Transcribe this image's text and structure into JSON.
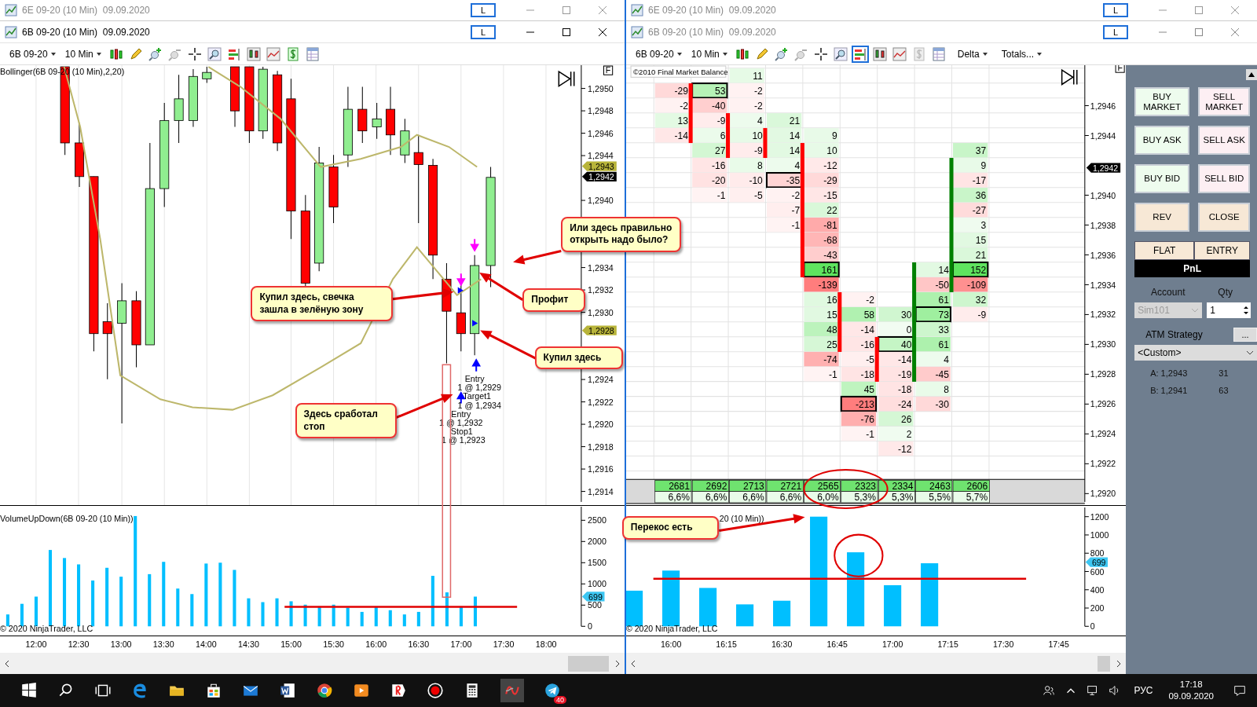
{
  "background_windows": [
    {
      "title": "6E 09-20 (10 Min)  09.09.2020",
      "button": "L"
    },
    {
      "title": "6E 09-20 (10 Min)  09.09.2020",
      "button": "L"
    }
  ],
  "left_window": {
    "title": "6B 09-20 (10 Min)  09.09.2020",
    "button": "L",
    "toolbar": {
      "instrument": "6B 09-20",
      "interval": "10 Min"
    },
    "indicator_label": "Bollinger(6B 09-20 (10 Min),2,20)",
    "flag": "F",
    "price_axis": [
      "1,2950",
      "1,2948",
      "1,2946",
      "1,2944",
      "1,2940",
      "1,2934",
      "1,2932",
      "1,2930",
      "1,2924",
      "1,2922",
      "1,2920",
      "1,2918",
      "1,2916",
      "1,2914"
    ],
    "price_markers": [
      {
        "text": "1,2943",
        "kind": "band"
      },
      {
        "text": "1,2942",
        "kind": "last"
      },
      {
        "text": "1,2928",
        "kind": "band"
      }
    ],
    "order_labels": [
      "Entry",
      "1 @ 1,2929",
      "Target1",
      "1 @ 1,2934",
      "Entry",
      "1 @ 1,2932",
      "Stop1",
      "1 @ 1,2923"
    ],
    "volume": {
      "label": "VolumeUpDown(6B 09-20 (10 Min))",
      "copyright": "© 2020 NinjaTrader, LLC",
      "chart_data": {
        "type": "bar",
        "ylim": [
          0,
          2820
        ],
        "yticks": [
          0,
          500,
          1000,
          1500,
          2000,
          2500
        ],
        "annotations": [
          "699"
        ],
        "categories": [
          null,
          null,
          "12:00",
          null,
          null,
          "12:30",
          null,
          null,
          "13:00",
          null,
          null,
          "13:30",
          null,
          null,
          "14:00",
          null,
          null,
          "14:30",
          null,
          null,
          "15:00",
          null,
          null,
          "15:30",
          null,
          null,
          "16:00",
          null,
          null,
          "16:30",
          null,
          null,
          "17:00",
          null,
          null,
          "17:30",
          null,
          null,
          "18:00"
        ],
        "values": [
          280,
          530,
          700,
          1800,
          1610,
          1460,
          1080,
          1380,
          1170,
          2600,
          1230,
          1520,
          890,
          760,
          1480,
          1500,
          1330,
          660,
          570,
          660,
          590,
          510,
          470,
          510,
          440,
          340,
          470,
          380,
          280,
          340,
          1190,
          800,
          470,
          700,
          null,
          null,
          null,
          null,
          null
        ]
      }
    }
  },
  "right_window": {
    "title": "6B 09-20 (10 Min)  09.09.2020",
    "button": "L",
    "toolbar": {
      "instrument": "6B 09-20",
      "interval": "10 Min",
      "menus": [
        "Delta",
        "Totals..."
      ]
    },
    "flag": "F",
    "watermark": "©2010 Final Market Balance",
    "footprint": {
      "rows": [
        [
          null,
          null,
          {
            "text": "11",
            "boxed": false
          },
          null,
          null,
          null,
          null,
          null,
          null
        ],
        [
          {
            "text": "-29",
            "boxed": false
          },
          {
            "text": "53",
            "boxed": true
          },
          {
            "text": "-2",
            "boxed": false
          },
          null,
          null,
          null,
          null,
          null,
          null
        ],
        [
          {
            "text": "-2",
            "boxed": false
          },
          {
            "text": "-40",
            "boxed": false
          },
          {
            "text": "-2",
            "boxed": false
          },
          null,
          null,
          null,
          null,
          null,
          null
        ],
        [
          {
            "text": "13",
            "boxed": false
          },
          {
            "text": "-9",
            "boxed": false
          },
          {
            "text": "4",
            "boxed": false
          },
          {
            "text": "21",
            "boxed": false
          },
          null,
          null,
          null,
          null,
          null
        ],
        [
          {
            "text": "-14",
            "boxed": false
          },
          {
            "text": "6",
            "boxed": false
          },
          {
            "text": "10",
            "boxed": false
          },
          {
            "text": "14",
            "boxed": false
          },
          {
            "text": "9",
            "boxed": false
          },
          null,
          null,
          null,
          null
        ],
        [
          null,
          {
            "text": "27",
            "boxed": false
          },
          {
            "text": "-9",
            "boxed": false
          },
          {
            "text": "14",
            "boxed": false
          },
          {
            "text": "10",
            "boxed": false
          },
          null,
          null,
          null,
          {
            "text": "37",
            "boxed": false
          }
        ],
        [
          null,
          {
            "text": "-16",
            "boxed": false
          },
          {
            "text": "8",
            "boxed": false
          },
          {
            "text": "4",
            "boxed": false
          },
          {
            "text": "-12",
            "boxed": false
          },
          null,
          null,
          null,
          {
            "text": "9",
            "boxed": false
          }
        ],
        [
          null,
          {
            "text": "-20",
            "boxed": false
          },
          {
            "text": "-10",
            "boxed": false
          },
          {
            "text": "-35",
            "boxed": true
          },
          {
            "text": "-29",
            "boxed": false
          },
          null,
          null,
          null,
          {
            "text": "-17",
            "boxed": false
          }
        ],
        [
          null,
          {
            "text": "-1",
            "boxed": false
          },
          {
            "text": "-5",
            "boxed": false
          },
          {
            "text": "-2",
            "boxed": false
          },
          {
            "text": "-15",
            "boxed": false
          },
          null,
          null,
          null,
          {
            "text": "36",
            "boxed": false
          }
        ],
        [
          null,
          null,
          null,
          {
            "text": "-7",
            "boxed": false
          },
          {
            "text": "22",
            "boxed": false
          },
          null,
          null,
          null,
          {
            "text": "-27",
            "boxed": false
          }
        ],
        [
          null,
          null,
          null,
          {
            "text": "-1",
            "boxed": false
          },
          {
            "text": "-81",
            "boxed": false
          },
          null,
          null,
          null,
          {
            "text": "3",
            "boxed": false
          }
        ],
        [
          null,
          null,
          null,
          null,
          {
            "text": "-68",
            "boxed": false
          },
          null,
          null,
          null,
          {
            "text": "15",
            "boxed": false
          }
        ],
        [
          null,
          null,
          null,
          null,
          {
            "text": "-43",
            "boxed": false
          },
          null,
          null,
          null,
          {
            "text": "21",
            "boxed": false
          }
        ],
        [
          null,
          null,
          null,
          null,
          {
            "text": "161",
            "boxed": true
          },
          null,
          null,
          {
            "text": "14",
            "boxed": false
          },
          {
            "text": "152",
            "boxed": true
          }
        ],
        [
          null,
          null,
          null,
          null,
          {
            "text": "-139",
            "boxed": false
          },
          null,
          null,
          {
            "text": "-50",
            "boxed": false
          },
          {
            "text": "-109",
            "boxed": false
          }
        ],
        [
          null,
          null,
          null,
          null,
          {
            "text": "16",
            "boxed": false
          },
          {
            "text": "-2",
            "boxed": false
          },
          null,
          {
            "text": "61",
            "boxed": false
          },
          {
            "text": "32",
            "boxed": false
          }
        ],
        [
          null,
          null,
          null,
          null,
          {
            "text": "15",
            "boxed": false
          },
          {
            "text": "58",
            "boxed": false
          },
          {
            "text": "30",
            "boxed": false
          },
          {
            "text": "73",
            "boxed": true
          },
          {
            "text": "-9",
            "boxed": false
          }
        ],
        [
          null,
          null,
          null,
          null,
          {
            "text": "48",
            "boxed": false
          },
          {
            "text": "-14",
            "boxed": false
          },
          {
            "text": "0",
            "boxed": false
          },
          {
            "text": "33",
            "boxed": false
          },
          null
        ],
        [
          null,
          null,
          null,
          null,
          {
            "text": "25",
            "boxed": false
          },
          {
            "text": "-16",
            "boxed": false
          },
          {
            "text": "40",
            "boxed": true
          },
          {
            "text": "61",
            "boxed": false
          },
          null
        ],
        [
          null,
          null,
          null,
          null,
          {
            "text": "-74",
            "boxed": false
          },
          {
            "text": "-5",
            "boxed": false
          },
          {
            "text": "-14",
            "boxed": false
          },
          {
            "text": "4",
            "boxed": false
          },
          null
        ],
        [
          null,
          null,
          null,
          null,
          {
            "text": "-1",
            "boxed": false
          },
          {
            "text": "-18",
            "boxed": false
          },
          {
            "text": "-19",
            "boxed": false
          },
          {
            "text": "-45",
            "boxed": false
          },
          null
        ],
        [
          null,
          null,
          null,
          null,
          null,
          {
            "text": "45",
            "boxed": false
          },
          {
            "text": "-18",
            "boxed": false
          },
          {
            "text": "8",
            "boxed": false
          },
          null
        ],
        [
          null,
          null,
          null,
          null,
          null,
          {
            "text": "-213",
            "boxed": true
          },
          {
            "text": "-24",
            "boxed": false
          },
          {
            "text": "-30",
            "boxed": false
          },
          null
        ],
        [
          null,
          null,
          null,
          null,
          null,
          {
            "text": "-76",
            "boxed": false
          },
          {
            "text": "26",
            "boxed": false
          },
          null,
          null
        ],
        [
          null,
          null,
          null,
          null,
          null,
          {
            "text": "-1",
            "boxed": false
          },
          {
            "text": "2",
            "boxed": false
          },
          null,
          null
        ],
        [
          null,
          null,
          null,
          null,
          null,
          null,
          {
            "text": "-12",
            "boxed": false
          },
          null,
          null
        ]
      ],
      "totals": [
        "2681",
        "2692",
        "2713",
        "2721",
        "2565",
        "2323",
        "2334",
        "2463",
        "2606"
      ],
      "percents": [
        "6,6%",
        "6,6%",
        "6,6%",
        "6,6%",
        "6,0%",
        "5,3%",
        "5,3%",
        "5,5%",
        "5,7%"
      ]
    },
    "price_axis": [
      "1,2946",
      "1,2944",
      "1,2940",
      "1,2938",
      "1,2936",
      "1,2934",
      "1,2932",
      "1,2930",
      "1,2928",
      "1,2926",
      "1,2924",
      "1,2922",
      "1,2920"
    ],
    "price_marker": "1,2942",
    "volume": {
      "label": "20 (10 Min))",
      "copyright": "© 2020 NinjaTrader, LLC",
      "chart_data": {
        "type": "bar",
        "ylim": [
          0,
          1300
        ],
        "yticks": [
          0,
          200,
          400,
          600,
          800,
          1000,
          1200
        ],
        "annotations": [
          "699"
        ],
        "categories": [
          null,
          null,
          "16:00",
          null,
          null,
          "16:15",
          null,
          null,
          "16:30",
          null,
          null,
          "16:45",
          null,
          null,
          "17:00",
          null,
          null,
          "17:15",
          null,
          null,
          "17:30",
          null,
          null,
          "17:45"
        ],
        "values": [
          390,
          null,
          610,
          null,
          420,
          null,
          240,
          null,
          280,
          null,
          1200,
          null,
          810,
          null,
          450,
          null,
          690,
          null,
          null,
          null,
          null,
          null,
          null,
          null
        ]
      }
    }
  },
  "order_panel": {
    "buttons": [
      {
        "label": "BUY MARKET",
        "kind": "buy"
      },
      {
        "label": "SELL MARKET",
        "kind": "sell"
      },
      {
        "label": "BUY ASK",
        "kind": "buy"
      },
      {
        "label": "SELL ASK",
        "kind": "sell"
      },
      {
        "label": "BUY BID",
        "kind": "buy"
      },
      {
        "label": "SELL BID",
        "kind": "sell"
      },
      {
        "label": "REV",
        "kind": "neutral"
      },
      {
        "label": "CLOSE",
        "kind": "neutral"
      }
    ],
    "position_cells": [
      "FLAT",
      "ENTRY"
    ],
    "pnl": "PnL",
    "account_label": "Account",
    "qty_label": "Qty",
    "account": "Sim101",
    "qty": "1",
    "atm_label": "ATM Strategy",
    "atm_button": "...",
    "atm_value": "<Custom>",
    "quotes": [
      {
        "label": "A: 1,2943",
        "size": "31"
      },
      {
        "label": "B: 1,2941",
        "size": "63"
      }
    ]
  },
  "callouts": [
    "Или здесь правильно открыть надо было?",
    "Купил здесь, свечка зашла в зелёную зону",
    "Профит",
    "Купил здесь",
    "Здесь сработал стоп",
    "Перекос есть"
  ],
  "taskbar": {
    "badge": "40",
    "language": "РУС",
    "time": "17:18",
    "date": "09.09.2020"
  }
}
